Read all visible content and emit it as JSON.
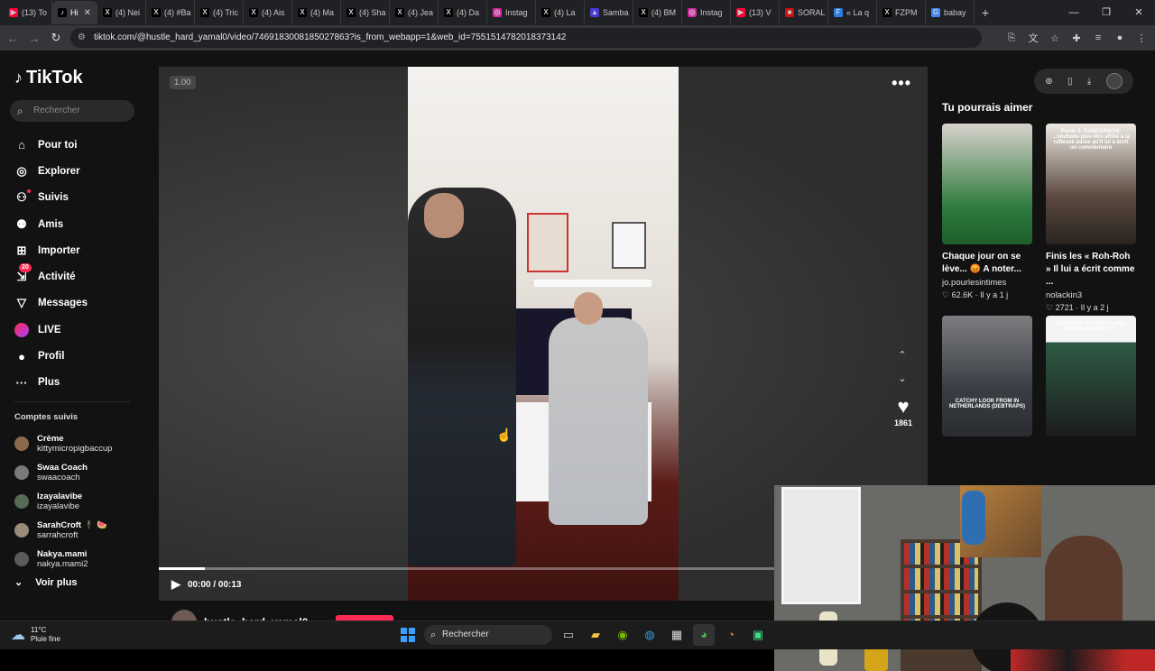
{
  "browser": {
    "tabs": [
      {
        "label": "(13) To",
        "fav_color": "#ff0033",
        "fav_glyph": "▶"
      },
      {
        "label": "Hi",
        "fav_color": "#000000",
        "fav_glyph": "♪",
        "active": true
      },
      {
        "label": "(4) Nei",
        "fav_color": "#000000",
        "fav_glyph": "X"
      },
      {
        "label": "(4) #Ba",
        "fav_color": "#000000",
        "fav_glyph": "X"
      },
      {
        "label": "(4) Tric",
        "fav_color": "#000000",
        "fav_glyph": "X"
      },
      {
        "label": "(4) Ais",
        "fav_color": "#000000",
        "fav_glyph": "X"
      },
      {
        "label": "(4) Ma",
        "fav_color": "#000000",
        "fav_glyph": "X"
      },
      {
        "label": "(4) Sha",
        "fav_color": "#000000",
        "fav_glyph": "X"
      },
      {
        "label": "(4) Jea",
        "fav_color": "#000000",
        "fav_glyph": "X"
      },
      {
        "label": "(4) Da",
        "fav_color": "#000000",
        "fav_glyph": "X"
      },
      {
        "label": "Instag",
        "fav_color": "#d6249f",
        "fav_glyph": "◎"
      },
      {
        "label": "(4) La",
        "fav_color": "#000000",
        "fav_glyph": "X"
      },
      {
        "label": "Samba",
        "fav_color": "#4b3bd1",
        "fav_glyph": "▲"
      },
      {
        "label": "(4) BM",
        "fav_color": "#000000",
        "fav_glyph": "X"
      },
      {
        "label": "Instag",
        "fav_color": "#d6249f",
        "fav_glyph": "◎"
      },
      {
        "label": "(13) V",
        "fav_color": "#ff0033",
        "fav_glyph": "▶"
      },
      {
        "label": "SORAL",
        "fav_color": "#cc1111",
        "fav_glyph": "■"
      },
      {
        "label": "« La q",
        "fav_color": "#2a7de1",
        "fav_glyph": "F"
      },
      {
        "label": "FZPM",
        "fav_color": "#000000",
        "fav_glyph": "X"
      },
      {
        "label": "babay",
        "fav_color": "#4285f4",
        "fav_glyph": "G"
      }
    ],
    "new_tab_label": "+",
    "url": "tiktok.com/@hustle_hard_yamal0/video/7469183008185027863?is_from_webapp=1&web_id=7551514782018373142"
  },
  "sidebar": {
    "logo_text": "TikTok",
    "search_placeholder": "Rechercher",
    "nav": [
      {
        "label": "Pour toi",
        "icon": "home-icon",
        "glyph": "⌂"
      },
      {
        "label": "Explorer",
        "icon": "compass-icon",
        "glyph": "◎"
      },
      {
        "label": "Suivis",
        "icon": "following-icon",
        "glyph": "⚇",
        "dot": true
      },
      {
        "label": "Amis",
        "icon": "friends-icon",
        "glyph": "⚉"
      },
      {
        "label": "Importer",
        "icon": "upload-icon",
        "glyph": "⊞"
      },
      {
        "label": "Activité",
        "icon": "activity-icon",
        "glyph": "⇲",
        "badge": "20"
      },
      {
        "label": "Messages",
        "icon": "messages-icon",
        "glyph": "▽"
      },
      {
        "label": "LIVE",
        "icon": "live-icon",
        "glyph": "LIVE"
      },
      {
        "label": "Profil",
        "icon": "profile-avatar-icon",
        "glyph": "●"
      },
      {
        "label": "Plus",
        "icon": "more-icon",
        "glyph": "···"
      }
    ],
    "following_title": "Comptes suivis",
    "following": [
      {
        "name": "Crème",
        "handle": "kittymicropigbaccup",
        "color": "#8a6a4a"
      },
      {
        "name": "Swaa Coach",
        "handle": "swaacoach",
        "color": "#7a7a7a"
      },
      {
        "name": "Izayalavibe",
        "handle": "izayalavibe",
        "color": "#556b55"
      },
      {
        "name": "SarahCroft 🕴 🍉",
        "handle": "sarrahcroft",
        "color": "#9a8a7a"
      },
      {
        "name": "Nakya.mami",
        "handle": "nakya.mami2",
        "color": "#5a5a5a"
      }
    ],
    "see_more": "Voir plus"
  },
  "player": {
    "speed": "1.00",
    "more": "•••",
    "like_count": "1861",
    "time": "00:00 / 00:13",
    "progress_fraction": 0.06,
    "author": "hustle_hard_yamal0"
  },
  "right": {
    "title": "Tu pourrais aimer",
    "cards": [
      {
        "title": "Chaque jour on se lève... 😡 A noter...",
        "user": "jo.pourlesintimes",
        "likes": "62.6K",
        "age": "Il y a 1 j",
        "bg": "linear-gradient(#d8d2cc, #2d7a3c 70%, #1e5e2c)",
        "overlay": ""
      },
      {
        "title": "Finis les « Roh-Roh » Il lui a écrit comme ...",
        "user": "nolackin3",
        "likes": "2721",
        "age": "Il y a 2 j",
        "bg": "linear-gradient(#ece8e2, #5c4a40 60%, #2a2420)",
        "overlay": "Partie 2: DANGERSON: ...souhaite plus être affilié à la rafleuse parce qu'il lui a écrit un commentaire"
      },
      {
        "title": "",
        "user": "",
        "likes": "",
        "age": "",
        "bg": "linear-gradient(#7c7d80, #3a3e44 60%, #2a2c30)",
        "overlay": "CATCHY LOOK FROM IN NETHERLANDS (DEBTRAPS)"
      },
      {
        "title": "",
        "user": "",
        "likes": "",
        "age": "",
        "bg": "linear-gradient(#f4f4f4 0%, #f4f4f4 22%, #2e5a44 22%, #1c1c1c 100%)",
        "overlay": "L'industrie du fitness vous prend pour des c**s"
      }
    ]
  },
  "taskbar": {
    "temp": "11°C",
    "weather": "Pluie fine",
    "search_label": "Rechercher"
  }
}
